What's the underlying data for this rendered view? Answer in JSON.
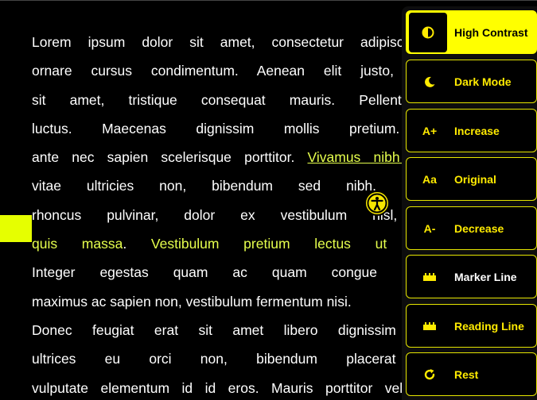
{
  "article": {
    "p1": [
      [
        "Lorem ipsum dolor sit amet, consectetur adipiscing elit. Nulla"
      ],
      [
        "ornare cursus condimentum. Aenean elit justo, tincidunt quis"
      ],
      [
        "sit amet, tristique consequat mauris. Pellentesque gravida"
      ],
      [
        "luctus. Maecenas dignissim mollis pretium. Suspendisse"
      ],
      [
        "ante nec sapien scelerisque porttitor. ",
        "Vivamus nibh purus, lobortis"
      ],
      [
        "vitae ultricies non, bibendum sed nibh. Proin rhoncus"
      ],
      [
        "rhoncus pulvinar, dolor ex vestibulum nisl, sed iaculis"
      ],
      [
        "quis massa",
        ". ",
        "Vestibulum pretium lectus ut erat rhoncus"
      ],
      [
        "Integer egestas quam ac quam congue mollis. Integer"
      ],
      [
        "maximus ac sapien non, vestibulum fermentum nisi."
      ]
    ],
    "p2": [
      [
        "Donec feugiat erat sit amet libero dignissim varius. Nulla"
      ],
      [
        "ultrices eu orci non, bibendum placerat arcu. Sed"
      ],
      [
        "vulputate elementum id id eros. Mauris porttitor vel velit sit amet"
      ]
    ]
  },
  "accessibility_menu": {
    "items": [
      {
        "id": "high-contrast",
        "icon": "contrast-icon",
        "label": "High Contrast",
        "active": true
      },
      {
        "id": "dark-mode",
        "icon": "moon-icon",
        "label": "Dark Mode"
      },
      {
        "id": "increase",
        "icon": "A+",
        "label": "Increase"
      },
      {
        "id": "original",
        "icon": "Aa",
        "label": "Original"
      },
      {
        "id": "decrease",
        "icon": "A-",
        "label": "Decrease"
      },
      {
        "id": "marker-line",
        "icon": "ruler-icon",
        "label": "Marker Line"
      },
      {
        "id": "reading-line",
        "icon": "ruler-icon",
        "label": "Reading Line"
      },
      {
        "id": "reset",
        "icon": "reset-icon",
        "label": "Rest"
      }
    ]
  },
  "colors": {
    "accent": "#ffff00",
    "background": "#000000",
    "link": "#e6ff4d"
  }
}
